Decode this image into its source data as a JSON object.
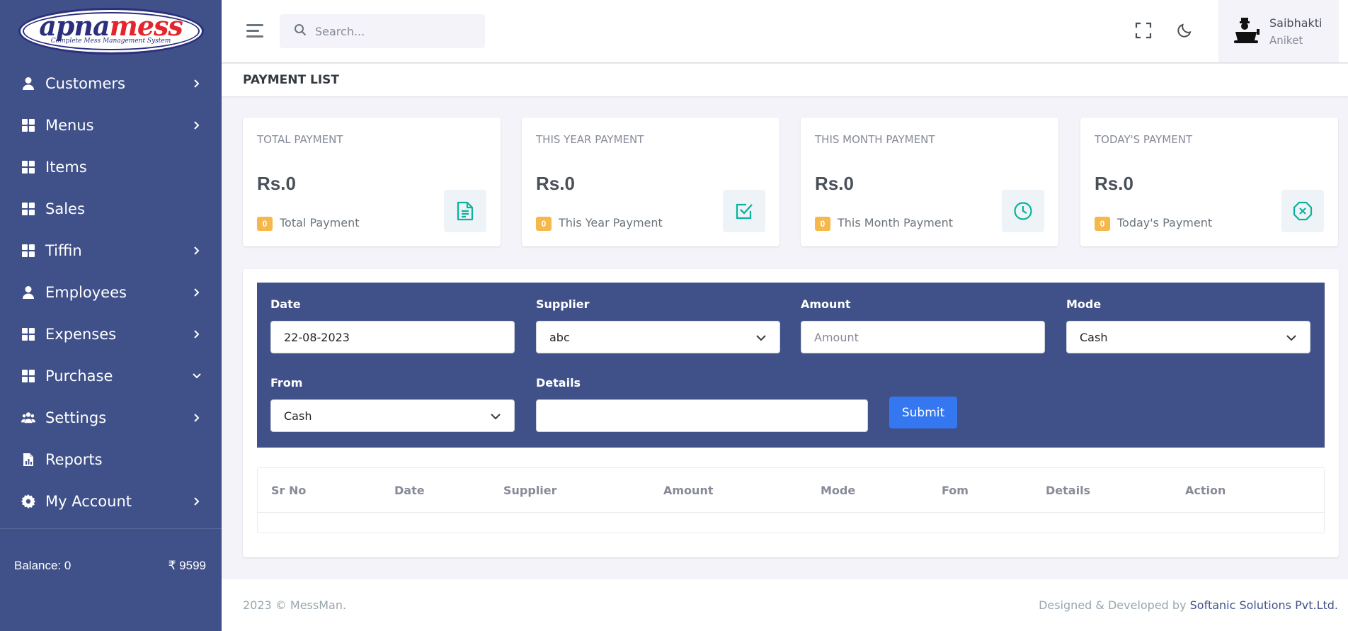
{
  "brand": {
    "logo_main_a": "apna",
    "logo_main_b": "mess",
    "logo_sub": "Complete Mess Management System"
  },
  "sidebar": {
    "items": [
      {
        "label": "Customers",
        "icon": "user-icon",
        "chevron": "right"
      },
      {
        "label": "Menus",
        "icon": "dashboard-grid-icon",
        "chevron": "right"
      },
      {
        "label": "Items",
        "icon": "dashboard-grid-icon",
        "chevron": ""
      },
      {
        "label": "Sales",
        "icon": "dashboard-grid-icon",
        "chevron": ""
      },
      {
        "label": "Tiffin",
        "icon": "dashboard-grid-icon",
        "chevron": "right"
      },
      {
        "label": "Employees",
        "icon": "user-icon",
        "chevron": "right"
      },
      {
        "label": "Expenses",
        "icon": "dashboard-grid-icon",
        "chevron": "right"
      },
      {
        "label": "Purchase",
        "icon": "dashboard-grid-icon",
        "chevron": "down"
      },
      {
        "label": "Settings",
        "icon": "users-group-icon",
        "chevron": "right"
      },
      {
        "label": "Reports",
        "icon": "report-file-icon",
        "chevron": ""
      },
      {
        "label": "My Account",
        "icon": "gear-icon",
        "chevron": "right"
      }
    ],
    "balance_label": "Balance: 0",
    "balance_amount": "₹ 9599"
  },
  "topbar": {
    "search_placeholder": "Search...",
    "user_name": "Saibhakti",
    "user_sub": "Aniket"
  },
  "page": {
    "title": "PAYMENT LIST"
  },
  "cards": [
    {
      "title": "TOTAL PAYMENT",
      "value": "Rs.0",
      "badge": "0",
      "sub": "Total Payment",
      "icon": "document-icon"
    },
    {
      "title": "THIS YEAR PAYMENT",
      "value": "Rs.0",
      "badge": "0",
      "sub": "This Year Payment",
      "icon": "checkbox-icon"
    },
    {
      "title": "THIS MONTH PAYMENT",
      "value": "Rs.0",
      "badge": "0",
      "sub": "This Month Payment",
      "icon": "clock-icon"
    },
    {
      "title": "TODAY'S PAYMENT",
      "value": "Rs.0",
      "badge": "0",
      "sub": "Today's Payment",
      "icon": "close-octagon-icon"
    }
  ],
  "form": {
    "date_label": "Date",
    "date_value": "22-08-2023",
    "supplier_label": "Supplier",
    "supplier_value": "abc",
    "amount_label": "Amount",
    "amount_placeholder": "Amount",
    "mode_label": "Mode",
    "mode_value": "Cash",
    "from_label": "From",
    "from_value": "Cash",
    "details_label": "Details",
    "details_value": "",
    "submit_label": "Submit"
  },
  "table": {
    "headers": [
      "Sr No",
      "Date",
      "Supplier",
      "Amount",
      "Mode",
      "Fom",
      "Details",
      "Action"
    ]
  },
  "footer": {
    "left": "2023 © MessMan.",
    "right_prefix": "Designed & Developed by ",
    "right_link": "Softanic Solutions Pvt.Ltd."
  },
  "colors": {
    "sidebar": "#405189",
    "accent": "#3577f1",
    "badge": "#f7b84b",
    "icon_teal": "#0ab39c"
  }
}
